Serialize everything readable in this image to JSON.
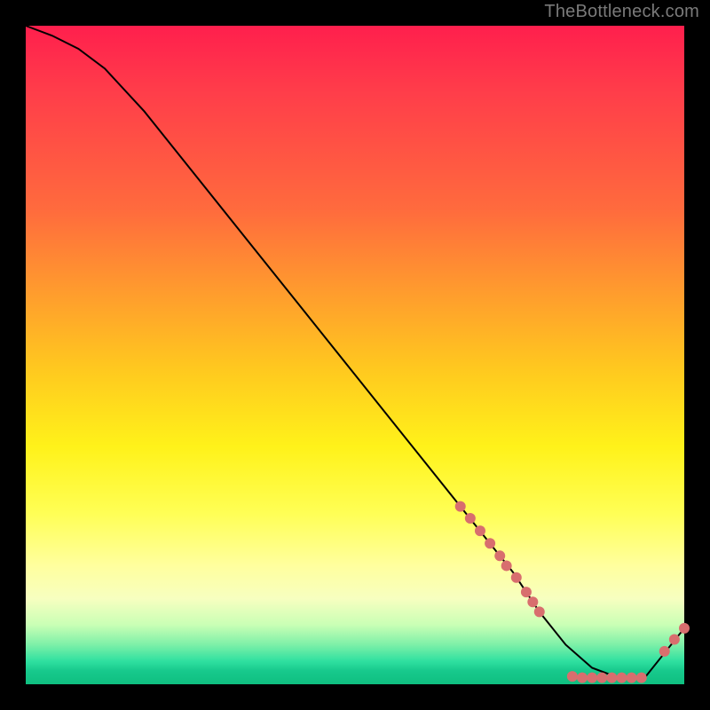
{
  "attribution": "TheBottleneck.com",
  "chart_data": {
    "type": "line",
    "title": "",
    "xlabel": "",
    "ylabel": "",
    "xlim": [
      0,
      100
    ],
    "ylim": [
      0,
      100
    ],
    "x": [
      0,
      4,
      8,
      12,
      18,
      26,
      34,
      42,
      50,
      58,
      66,
      70,
      74,
      78,
      82,
      86,
      90,
      94,
      100
    ],
    "values": [
      100,
      98.5,
      96.5,
      93.5,
      87,
      77,
      67,
      57,
      47,
      37,
      27,
      22,
      17,
      11,
      6,
      2.5,
      1,
      1,
      8.5
    ],
    "markers": [
      {
        "x": 66.0,
        "y": 27.0
      },
      {
        "x": 67.5,
        "y": 25.2
      },
      {
        "x": 69.0,
        "y": 23.3
      },
      {
        "x": 70.5,
        "y": 21.4
      },
      {
        "x": 72.0,
        "y": 19.5
      },
      {
        "x": 73.0,
        "y": 18.0
      },
      {
        "x": 74.5,
        "y": 16.2
      },
      {
        "x": 76.0,
        "y": 14.0
      },
      {
        "x": 77.0,
        "y": 12.5
      },
      {
        "x": 78.0,
        "y": 11.0
      },
      {
        "x": 83.0,
        "y": 1.2
      },
      {
        "x": 84.5,
        "y": 1.0
      },
      {
        "x": 86.0,
        "y": 1.0
      },
      {
        "x": 87.5,
        "y": 1.0
      },
      {
        "x": 89.0,
        "y": 1.0
      },
      {
        "x": 90.5,
        "y": 1.0
      },
      {
        "x": 92.0,
        "y": 1.0
      },
      {
        "x": 93.5,
        "y": 1.0
      },
      {
        "x": 97.0,
        "y": 5.0
      },
      {
        "x": 98.5,
        "y": 6.8
      },
      {
        "x": 100.0,
        "y": 8.5
      }
    ],
    "marker_color": "#d86e6e",
    "line_color": "#000000"
  }
}
